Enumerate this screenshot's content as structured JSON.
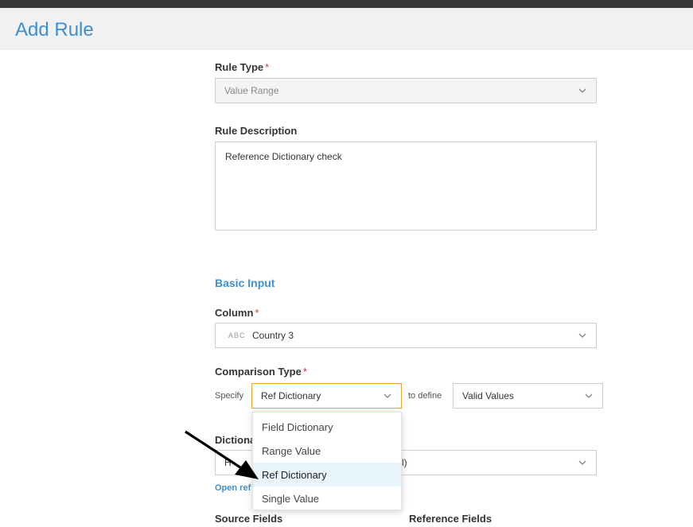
{
  "header": {
    "title": "Add Rule"
  },
  "rule_type": {
    "label": "Rule Type",
    "required_mark": "*",
    "value": "Value Range"
  },
  "rule_description": {
    "label": "Rule Description",
    "value": "Reference Dictionary check"
  },
  "basic_input": {
    "title": "Basic Input"
  },
  "column": {
    "label": "Column",
    "required_mark": "*",
    "type_badge": "ABC",
    "value": "Country 3"
  },
  "comparison_type": {
    "label": "Comparison Type",
    "required_mark": "*",
    "specify_label": "Specify",
    "value": "Ref Dictionary",
    "to_define_label": "to define",
    "define_value": "Valid Values",
    "options": [
      "Field Dictionary",
      "Range Value",
      "Ref Dictionary",
      "Single Value"
    ],
    "selected_index": 2
  },
  "dictionary": {
    "label_partial": "Dictiona",
    "value_prefix": "H",
    "value_suffix": "l)"
  },
  "open_ref_link": "Open ref",
  "source_fields": "Source Fields",
  "reference_fields": "Reference Fields",
  "colors": {
    "accent": "#3d8fd0",
    "required": "#d9342b",
    "focus": "#f0a030",
    "selected_bg": "#e7f4fb"
  },
  "icons": [
    "chevron-down-icon",
    "arrow-pointer-icon"
  ]
}
